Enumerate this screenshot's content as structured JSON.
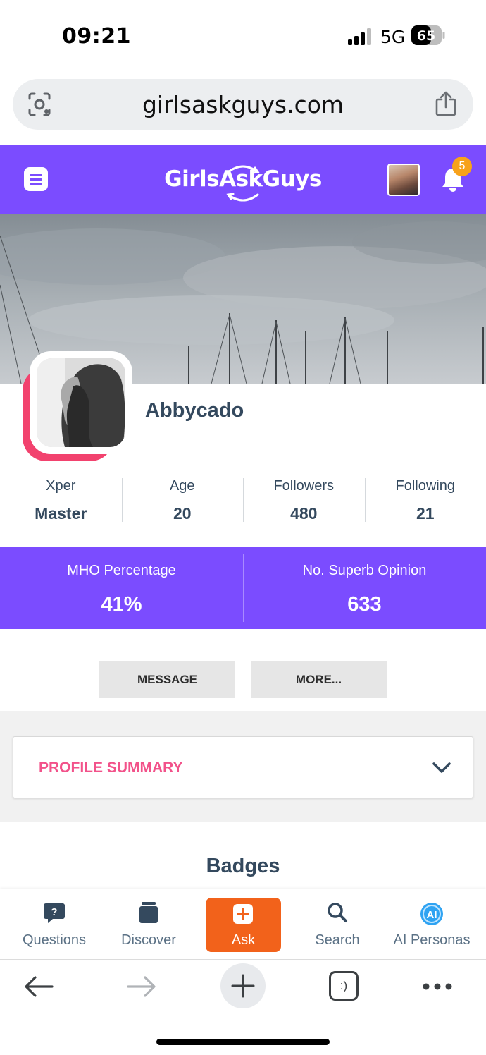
{
  "status_bar": {
    "time": "09:21",
    "network": "5G",
    "battery": "65"
  },
  "browser": {
    "url": "girlsaskguys.com"
  },
  "header": {
    "brand": "GirlsAskGuys",
    "notification_count": "5"
  },
  "profile": {
    "username": "Abbycado",
    "stats": [
      {
        "label": "Xper",
        "value": "Master"
      },
      {
        "label": "Age",
        "value": "20"
      },
      {
        "label": "Followers",
        "value": "480"
      },
      {
        "label": "Following",
        "value": "21"
      }
    ],
    "highlights": [
      {
        "label": "MHO Percentage",
        "value": "41%"
      },
      {
        "label": "No. Superb Opinion",
        "value": "633"
      }
    ],
    "message_button": "MESSAGE",
    "more_button": "MORE...",
    "summary_title": "PROFILE SUMMARY",
    "badges_title": "Badges"
  },
  "bottom_nav": {
    "items": [
      {
        "label": "Questions",
        "icon": "question-bubble-icon"
      },
      {
        "label": "Discover",
        "icon": "cards-icon"
      },
      {
        "label": "Ask",
        "icon": "plus-box-icon"
      },
      {
        "label": "Search",
        "icon": "search-icon"
      },
      {
        "label": "AI Personas",
        "icon": "ai-icon"
      }
    ]
  },
  "browser_toolbar": {
    "tabs_icon_text": ":)"
  },
  "colors": {
    "brand_purple": "#7b4cff",
    "accent_pink": "#f2528a",
    "ask_orange": "#f2621b",
    "badge_orange": "#f7a21b"
  }
}
